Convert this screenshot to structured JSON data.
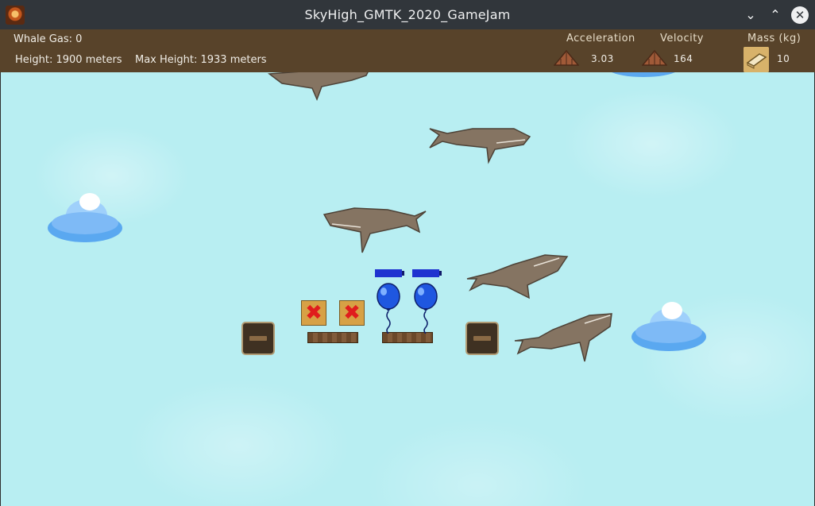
{
  "window": {
    "title": "SkyHigh_GMTK_2020_GameJam",
    "icon": "game-icon",
    "buttons": {
      "minimize": "⌄",
      "maximize": "⌃",
      "close": "✕"
    }
  },
  "hud": {
    "whale_gas": "Whale Gas: 0",
    "height": "Height: 1900 meters",
    "max_height": "Max Height: 1933 meters",
    "acceleration": {
      "label": "Acceleration",
      "value": "3.03",
      "icon": "up-arrow-icon"
    },
    "velocity": {
      "label": "Velocity",
      "value": "164",
      "icon": "up-arrow-icon"
    },
    "mass": {
      "label": "Mass (kg)",
      "value": "10",
      "icon": "gold-bar-icon"
    }
  },
  "scene": {
    "sky_color": "#b8eef2",
    "whales": 5,
    "clouds": 3,
    "balloons": 2,
    "remove_markers": 2,
    "crates": 2,
    "planks": 2
  },
  "colors": {
    "titlebar": "#31363b",
    "hud": "#58432a",
    "whale": "#857462",
    "balloon": "#1f57e0",
    "remove_mark": "#e01d1d"
  }
}
